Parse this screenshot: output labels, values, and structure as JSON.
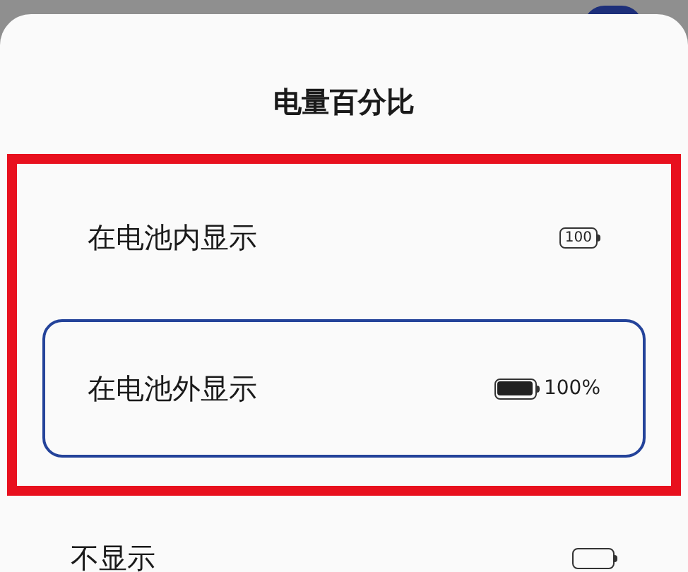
{
  "sheet": {
    "title": "电量百分比"
  },
  "options": [
    {
      "label": "在电池内显示",
      "kind": "inside",
      "preview_text": "100",
      "selected": false,
      "highlighted": true
    },
    {
      "label": "在电池外显示",
      "kind": "outside",
      "preview_text": "100%",
      "selected": true,
      "highlighted": true
    },
    {
      "label": "不显示",
      "kind": "none",
      "selected": false,
      "highlighted": false
    }
  ]
}
